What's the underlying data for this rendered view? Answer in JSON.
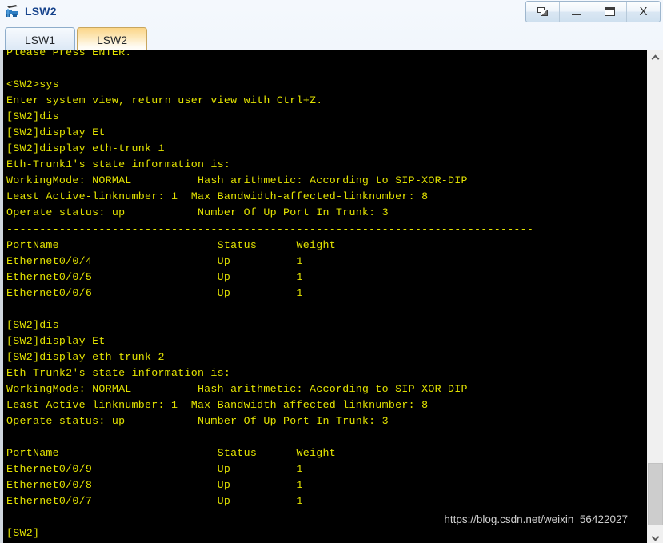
{
  "window": {
    "title": "LSW2",
    "icon": "switch-icon",
    "controls": [
      {
        "name": "restore-button",
        "glyph": "restore"
      },
      {
        "name": "minimize-button",
        "glyph": "minimize"
      },
      {
        "name": "maximize-button",
        "glyph": "maximize"
      },
      {
        "name": "close-button",
        "glyph": "close",
        "label": "X"
      }
    ]
  },
  "tabs": [
    {
      "label": "LSW1",
      "active": false
    },
    {
      "label": "LSW2",
      "active": true
    }
  ],
  "terminal": {
    "foreground": "#e2e200",
    "background": "#000000",
    "content": "Please Press ENTER.\n\n<SW2>sys\nEnter system view, return user view with Ctrl+Z.\n[SW2]dis\n[SW2]display Et\n[SW2]display eth-trunk 1\nEth-Trunk1's state information is:\nWorkingMode: NORMAL          Hash arithmetic: According to SIP-XOR-DIP\nLeast Active-linknumber: 1  Max Bandwidth-affected-linknumber: 8\nOperate status: up           Number Of Up Port In Trunk: 3\n--------------------------------------------------------------------------------\nPortName                        Status      Weight\nEthernet0/0/4                   Up          1\nEthernet0/0/5                   Up          1\nEthernet0/0/6                   Up          1\n\n[SW2]dis\n[SW2]display Et\n[SW2]display eth-trunk 2\nEth-Trunk2's state information is:\nWorkingMode: NORMAL          Hash arithmetic: According to SIP-XOR-DIP\nLeast Active-linknumber: 1  Max Bandwidth-affected-linknumber: 8\nOperate status: up           Number Of Up Port In Trunk: 3\n--------------------------------------------------------------------------------\nPortName                        Status      Weight\nEthernet0/0/9                   Up          1\nEthernet0/0/8                   Up          1\nEthernet0/0/7                   Up          1\n\n[SW2]"
  },
  "watermark": {
    "text": "https://blog.csdn.net/weixin_56422027"
  },
  "scrollbar": {
    "up_arrow": "chevron-up-icon",
    "down_arrow": "chevron-down-icon"
  }
}
